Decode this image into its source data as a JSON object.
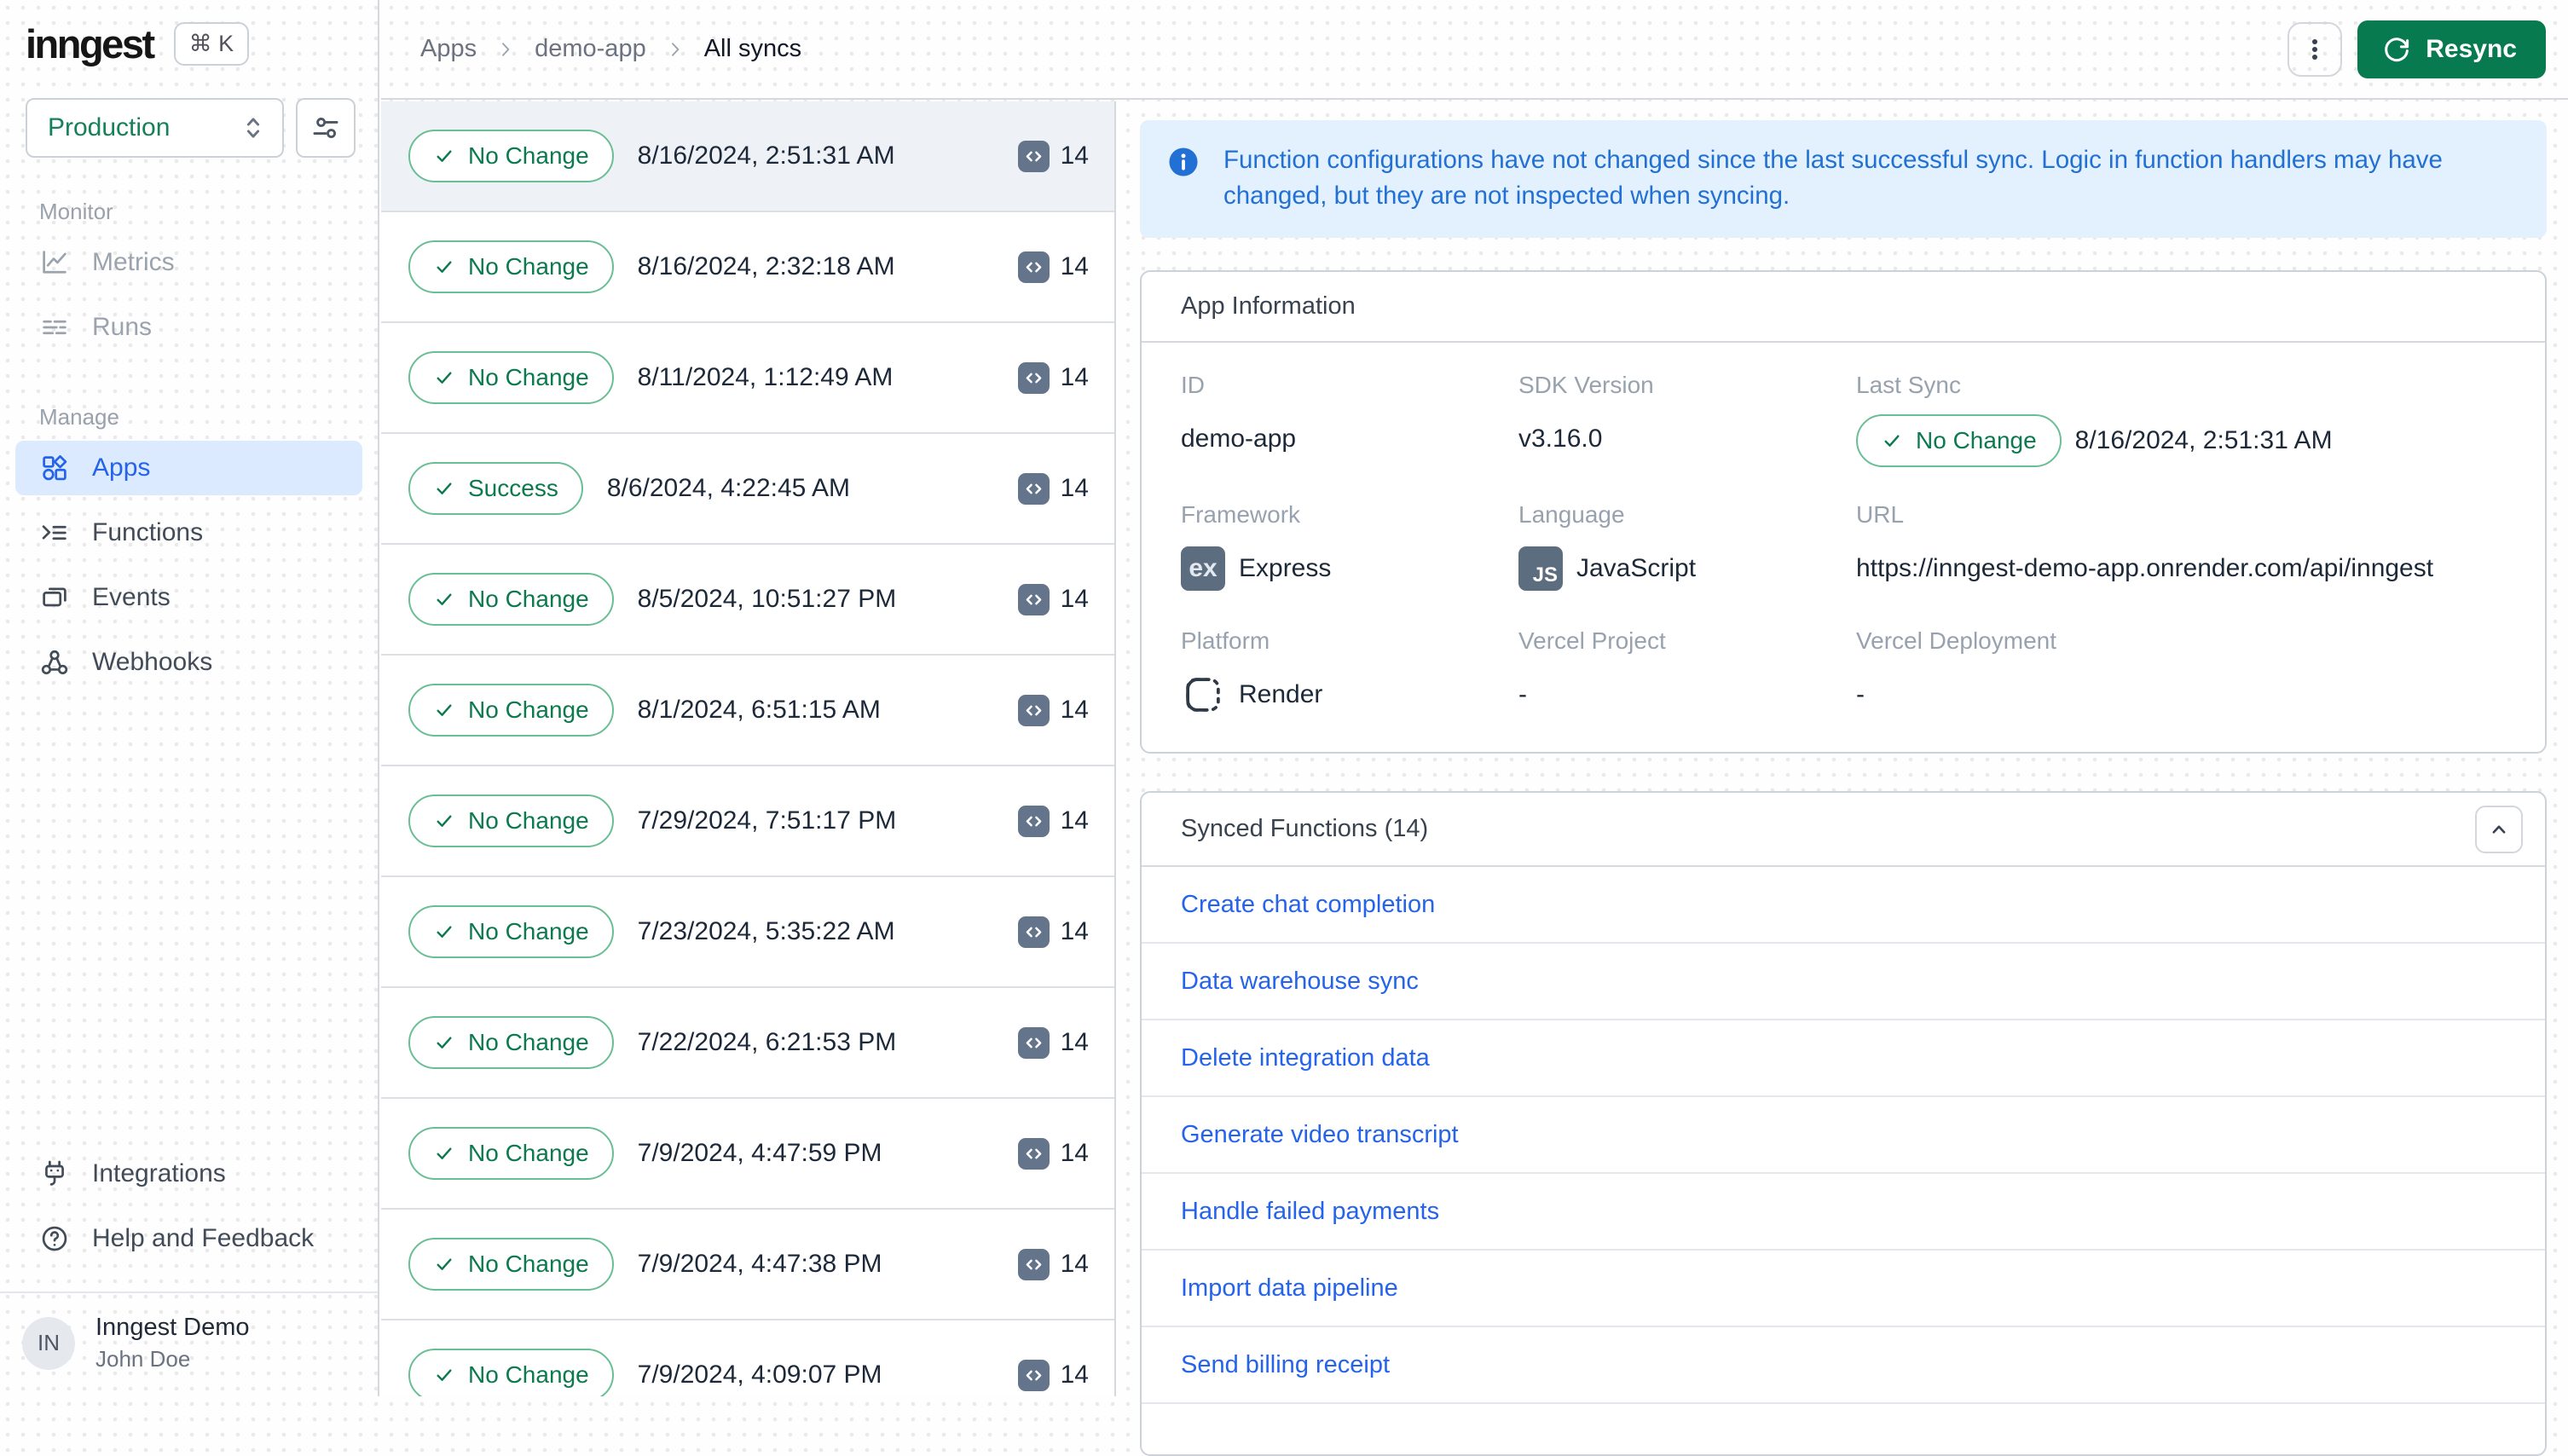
{
  "colors": {
    "brand_green": "#077a4f",
    "badge_green": "#0c7a4e",
    "active_blue": "#2563eb",
    "banner_blue": "#2270d4",
    "active_item_bg": "#dbeafe",
    "banner_bg": "#e3f1fe"
  },
  "sidebar": {
    "logo_text": "inngest",
    "shortcut_label": "⌘ K",
    "environment": "Production",
    "sections": [
      {
        "label": "Monitor",
        "items": [
          {
            "label": "Metrics",
            "icon": "metrics-icon",
            "state": "muted"
          },
          {
            "label": "Runs",
            "icon": "runs-icon",
            "state": "muted"
          }
        ]
      },
      {
        "label": "Manage",
        "items": [
          {
            "label": "Apps",
            "icon": "apps-icon",
            "state": "active"
          },
          {
            "label": "Functions",
            "icon": "functions-icon",
            "state": "default"
          },
          {
            "label": "Events",
            "icon": "events-icon",
            "state": "default"
          },
          {
            "label": "Webhooks",
            "icon": "webhooks-icon",
            "state": "default"
          }
        ]
      }
    ],
    "footer_items": [
      {
        "label": "Integrations",
        "icon": "integrations-icon",
        "state": "default"
      },
      {
        "label": "Help and Feedback",
        "icon": "help-icon",
        "state": "default"
      }
    ],
    "user": {
      "initials": "IN",
      "org": "Inngest Demo",
      "name": "John Doe"
    }
  },
  "header": {
    "breadcrumb": [
      "Apps",
      "demo-app",
      "All syncs"
    ],
    "resync_label": "Resync"
  },
  "sync_list": {
    "rows": [
      {
        "status": "No Change",
        "time": "8/16/2024, 2:51:31 AM",
        "function_count": "14",
        "selected": true
      },
      {
        "status": "No Change",
        "time": "8/16/2024, 2:32:18 AM",
        "function_count": "14"
      },
      {
        "status": "No Change",
        "time": "8/11/2024, 1:12:49 AM",
        "function_count": "14"
      },
      {
        "status": "Success",
        "time": "8/6/2024, 4:22:45 AM",
        "function_count": "14"
      },
      {
        "status": "No Change",
        "time": "8/5/2024, 10:51:27 PM",
        "function_count": "14"
      },
      {
        "status": "No Change",
        "time": "8/1/2024, 6:51:15 AM",
        "function_count": "14"
      },
      {
        "status": "No Change",
        "time": "7/29/2024, 7:51:17 PM",
        "function_count": "14"
      },
      {
        "status": "No Change",
        "time": "7/23/2024, 5:35:22 AM",
        "function_count": "14"
      },
      {
        "status": "No Change",
        "time": "7/22/2024, 6:21:53 PM",
        "function_count": "14"
      },
      {
        "status": "No Change",
        "time": "7/9/2024, 4:47:59 PM",
        "function_count": "14"
      },
      {
        "status": "No Change",
        "time": "7/9/2024, 4:47:38 PM",
        "function_count": "14"
      },
      {
        "status": "No Change",
        "time": "7/9/2024, 4:09:07 PM",
        "function_count": "14"
      }
    ]
  },
  "banner": {
    "text": "Function configurations have not changed since the last successful sync. Logic in function handlers may have changed, but they are not inspected when syncing."
  },
  "app_info": {
    "title": "App Information",
    "fields": [
      {
        "label": "ID",
        "value": "demo-app"
      },
      {
        "label": "SDK Version",
        "value": "v3.16.0"
      },
      {
        "label": "Last Sync",
        "badge": "No Change",
        "value": "8/16/2024, 2:51:31 AM"
      },
      {
        "label": "Framework",
        "value": "Express",
        "icon_text": "ex"
      },
      {
        "label": "Language",
        "value": "JavaScript",
        "icon_text": "JS"
      },
      {
        "label": "URL",
        "value": "https://inngest-demo-app.onrender.com/api/inngest"
      },
      {
        "label": "Platform",
        "value": "Render"
      },
      {
        "label": "Vercel Project",
        "value": "-"
      },
      {
        "label": "Vercel Deployment",
        "value": "-"
      }
    ]
  },
  "synced_functions": {
    "title": "Synced Functions (14)",
    "functions": [
      "Create chat completion",
      "Data warehouse sync",
      "Delete integration data",
      "Generate video transcript",
      "Handle failed payments",
      "Import data pipeline",
      "Send billing receipt"
    ]
  }
}
